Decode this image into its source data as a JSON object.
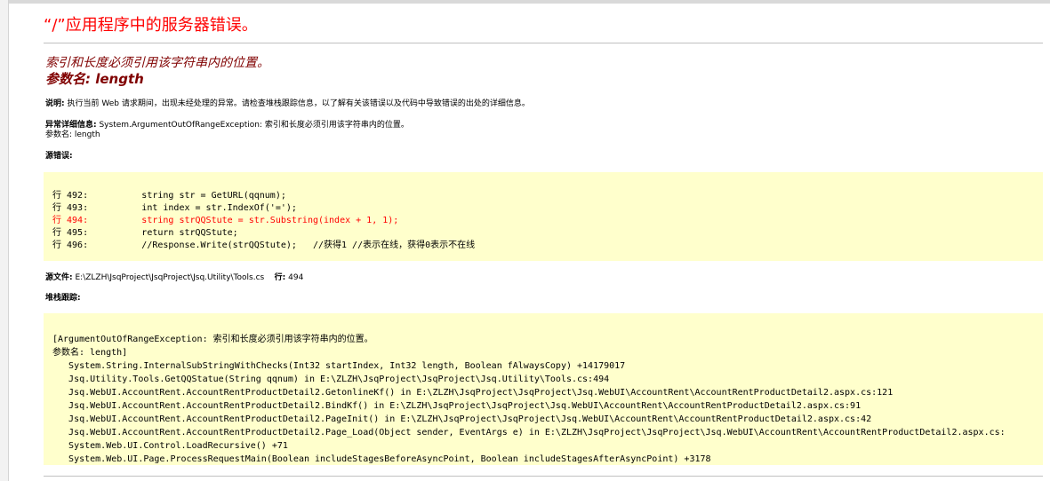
{
  "page": {
    "title": "“/”应用程序中的服务器错误。"
  },
  "error": {
    "message": "索引和长度必须引用该字符串内的位置。",
    "param_line": "参数名: length"
  },
  "description": {
    "label": "说明:",
    "text": " 执行当前 Web 请求期间，出现未经处理的异常。请检查堆栈跟踪信息，以了解有关该错误以及代码中导致错误的出处的详细信息。"
  },
  "exception": {
    "label": "异常详细信息:",
    "text": " System.ArgumentOutOfRangeException: 索引和长度必须引用该字符串内的位置。",
    "param": "参数名: length"
  },
  "source_error": {
    "label": "源错误:",
    "lines": [
      {
        "text": "行 492:          string str = GetURL(qqnum);",
        "highlight": false
      },
      {
        "text": "行 493:          int index = str.IndexOf('=');",
        "highlight": false
      },
      {
        "text": "行 494:          string strQQStute = str.Substring(index + 1, 1);",
        "highlight": true
      },
      {
        "text": "行 495:          return strQQStute;",
        "highlight": false
      },
      {
        "text": "行 496:          //Response.Write(strQQStute);   //获得1 //表示在线，获得0表示不在线",
        "highlight": false
      }
    ]
  },
  "source_file": {
    "label": "源文件:",
    "path": " E:\\ZLZH\\JsqProject\\JsqProject\\Jsq.Utility\\Tools.cs",
    "line_label": "行:",
    "line_value": " 494"
  },
  "stack": {
    "label": "堆栈跟踪:",
    "lines": [
      "[ArgumentOutOfRangeException: 索引和长度必须引用该字符串内的位置。",
      "参数名: length]",
      "   System.String.InternalSubStringWithChecks(Int32 startIndex, Int32 length, Boolean fAlwaysCopy) +14179017",
      "   Jsq.Utility.Tools.GetQQStatue(String qqnum) in E:\\ZLZH\\JsqProject\\JsqProject\\Jsq.Utility\\Tools.cs:494",
      "   Jsq.WebUI.AccountRent.AccountRentProductDetail2.GetonlineKf() in E:\\ZLZH\\JsqProject\\JsqProject\\Jsq.WebUI\\AccountRent\\AccountRentProductDetail2.aspx.cs:121",
      "   Jsq.WebUI.AccountRent.AccountRentProductDetail2.BindKf() in E:\\ZLZH\\JsqProject\\JsqProject\\Jsq.WebUI\\AccountRent\\AccountRentProductDetail2.aspx.cs:91",
      "   Jsq.WebUI.AccountRent.AccountRentProductDetail2.PageInit() in E:\\ZLZH\\JsqProject\\JsqProject\\Jsq.WebUI\\AccountRent\\AccountRentProductDetail2.aspx.cs:42",
      "   Jsq.WebUI.AccountRent.AccountRentProductDetail2.Page_Load(Object sender, EventArgs e) in E:\\ZLZH\\JsqProject\\JsqProject\\Jsq.WebUI\\AccountRent\\AccountRentProductDetail2.aspx.cs:",
      "   System.Web.UI.Control.LoadRecursive() +71",
      "   System.Web.UI.Page.ProcessRequestMain(Boolean includeStagesBeforeAsyncPoint, Boolean includeStagesAfterAsyncPoint) +3178"
    ]
  },
  "colors": {
    "title": "#ff0000",
    "message": "#800000",
    "code_background": "#ffffcc",
    "highlight_line": "#ff0000"
  }
}
